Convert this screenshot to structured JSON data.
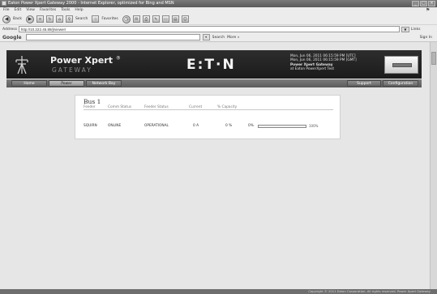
{
  "browser": {
    "title": "Eaton Power Xpert Gateway 2000 - Internet Explorer, optimized for Bing and MSN",
    "menu": [
      "File",
      "Edit",
      "View",
      "Favorites",
      "Tools",
      "Help"
    ],
    "toolbar": {
      "back_label": "Back",
      "search_label": "Search",
      "favorites_label": "Favorites"
    },
    "address": {
      "label": "Address",
      "value": "http://10.222.45.89/j/viewer/",
      "links": "Links"
    },
    "google": {
      "logo": "Google",
      "search_label": "Search",
      "more_label": "More »",
      "signin": "Sign In"
    }
  },
  "banner": {
    "product": "Power Xpert",
    "reg": "®",
    "gateway": "GATEWAY",
    "logo": "E:T·N",
    "info_line1": "Mon, Jun 06, 2011 06:15:59 PM [UTC]",
    "info_line2": "Mon, Jun 06, 2011 06:15:59 PM [GMT]",
    "info_line3": "Power Xpert Gateway",
    "info_line4": "at Eaton PowerXpert Test"
  },
  "nav": {
    "home": "Home",
    "power": "Power",
    "network": "Network Bay",
    "support": "Support",
    "configuration": "Configuration"
  },
  "bus": {
    "title": "Bus 1",
    "headers": [
      "Feeder",
      "Comm Status",
      "Feeder Status",
      "Current",
      "% Capacity"
    ],
    "row": {
      "feeder": "SQUIRN",
      "comm_status": "ONLINE",
      "feeder_status": "OPERATIONAL",
      "current": "0 A",
      "capacity": "0 %",
      "cap_min": "0%",
      "cap_max": "100%",
      "capacity_fraction": 0.0
    }
  },
  "status": {
    "text": "Copyright © 2011 Eaton Corporation. All rights reserved. Power Xpert Gateway"
  },
  "colors": {
    "banner": "#222222",
    "nav": "#6a6a6a",
    "page_bg": "#e6e6e6"
  }
}
